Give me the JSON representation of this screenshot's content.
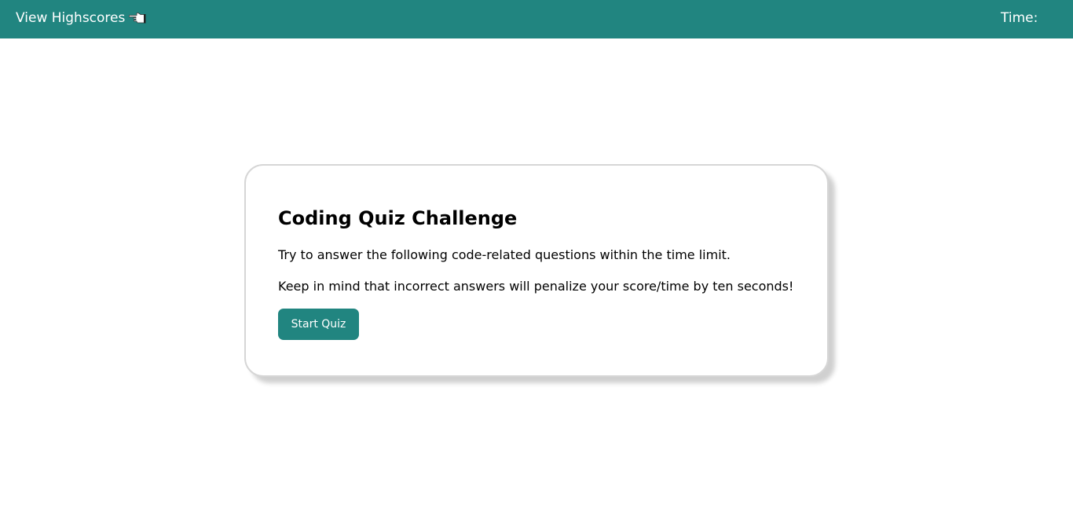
{
  "header": {
    "highscores_label": "View Highscores",
    "highscores_icon": "pointing-hand-icon",
    "timer_label": "Time:",
    "timer_value": ""
  },
  "quiz_card": {
    "title": "Coding Quiz Challenge",
    "paragraph_1": "Try to answer the following code-related questions within the time limit.",
    "paragraph_2": "Keep in mind that incorrect answers will penalize your score/time by ten seconds!",
    "start_button_label": "Start Quiz"
  },
  "colors": {
    "accent": "#218580",
    "background": "#ffffff",
    "text": "#000000"
  }
}
